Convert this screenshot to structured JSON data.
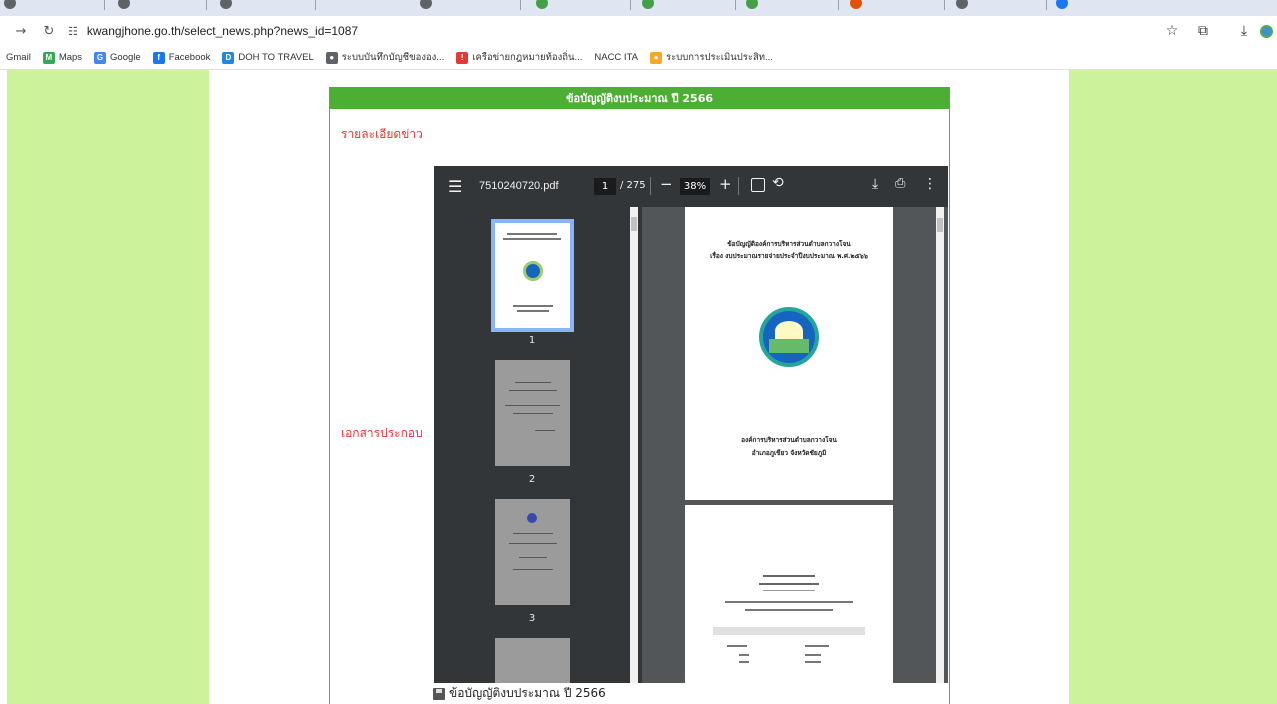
{
  "browser": {
    "address": "kwangjhone.go.th/select_news.php?news_id=1087",
    "bookmarks": [
      {
        "label": "Gmail",
        "color": "#ffffff",
        "glyph": ""
      },
      {
        "label": "Maps",
        "color": "#34a853",
        "glyph": "M"
      },
      {
        "label": "Google",
        "color": "#4285f4",
        "glyph": "G"
      },
      {
        "label": "Facebook",
        "color": "#1877f2",
        "glyph": "f"
      },
      {
        "label": "DOH TO TRAVEL",
        "color": "#1e88e5",
        "glyph": "D"
      },
      {
        "label": "ระบบบันทึกบัญชีขององ...",
        "color": "#5f6368",
        "glyph": "●"
      },
      {
        "label": "เครือข่ายกฎหมายท้องถิ่น...",
        "color": "#e53935",
        "glyph": "!"
      },
      {
        "label": "NACC ITA",
        "color": "#ffffff",
        "glyph": ""
      },
      {
        "label": "ระบบการประเมินประสิท...",
        "color": "#f9a825",
        "glyph": "●"
      }
    ]
  },
  "panel": {
    "header": "ข้อบัญญัติงบประมาณ ปี 2566",
    "detail_label": "รายละเอียดข่าว",
    "attach_label": "เอกสารประกอบ",
    "caption": "ข้อบัญญัติงบประมาณ ปี 2566"
  },
  "pdf": {
    "filename": "7510240720.pdf",
    "page": "1",
    "total": "/ 275",
    "zoom": "38%",
    "thumb_numbers": [
      "1",
      "2",
      "3"
    ],
    "page1": {
      "title1": "ข้อบัญญัติองค์การบริหารส่วนตำบลกวางโจน",
      "title2": "เรื่อง งบประมาณรายจ่ายประจำปีงบประมาณ พ.ศ.๒๕๖๖",
      "footer1": "องค์การบริหารส่วนตำบลกวางโจน",
      "footer2": "อำเภอภูเขียว จังหวัดชัยภูมิ"
    }
  },
  "colors": {
    "side": "#ccf29c",
    "header": "#4caf33",
    "label": "#e53935"
  }
}
